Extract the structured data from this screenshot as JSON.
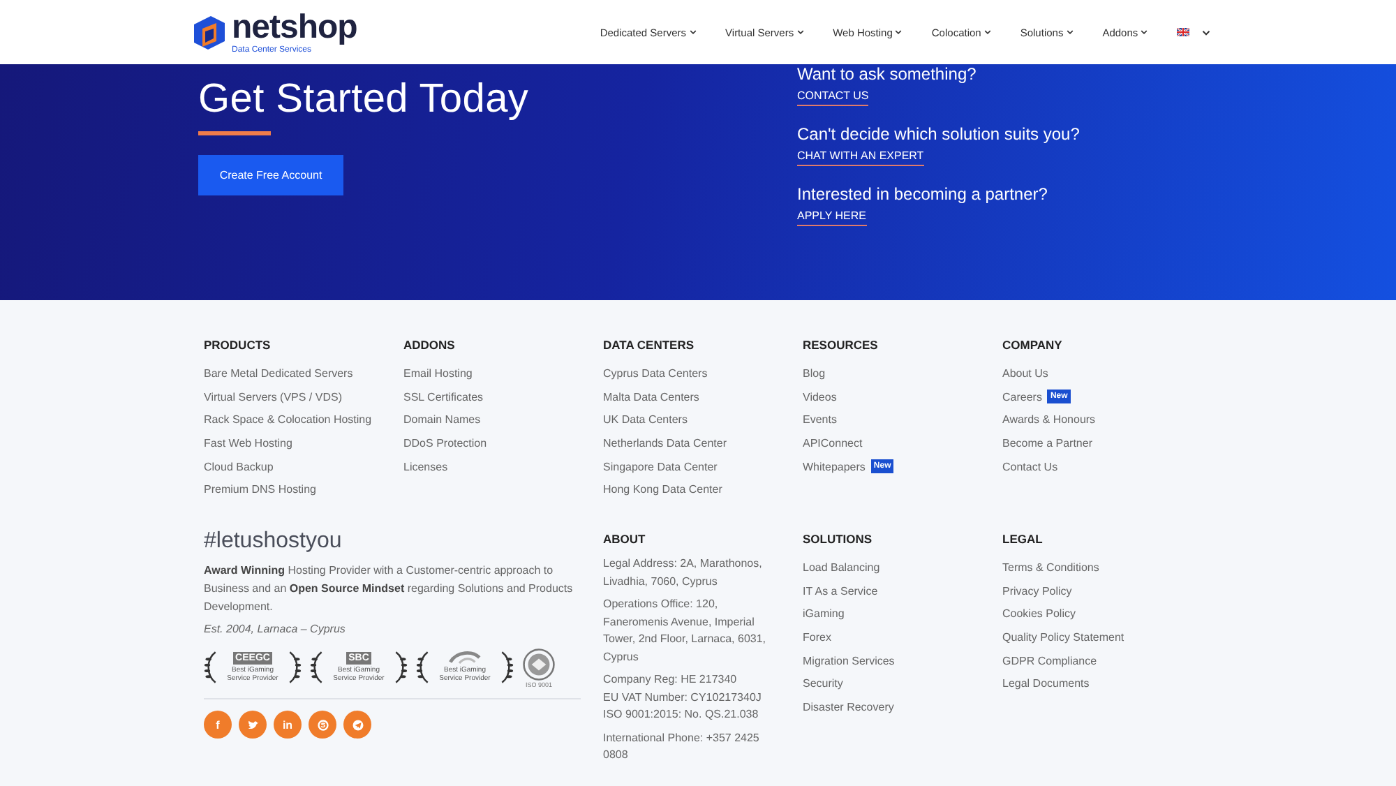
{
  "header": {
    "logo": {
      "name": "netshop",
      "tagline": "Data Center Services"
    },
    "nav": [
      {
        "label": "Dedicated Servers",
        "dropdown": true
      },
      {
        "label": "Virtual Servers",
        "dropdown": true
      },
      {
        "label": "Web Hosting",
        "dropdown": true
      },
      {
        "label": "Colocation",
        "dropdown": true
      },
      {
        "label": "Solutions",
        "dropdown": true
      },
      {
        "label": "Addons",
        "dropdown": true
      }
    ]
  },
  "hero": {
    "title": "Get Started Today",
    "button": "Create Free Account",
    "questions": [
      {
        "question": "Want to ask something?",
        "link": "CONTACT US"
      },
      {
        "question": "Can't decide which solution suits you?",
        "link": "CHAT WITH AN EXPERT"
      },
      {
        "question": "Interested in becoming a partner?",
        "link": "APPLY HERE"
      }
    ]
  },
  "columns": [
    {
      "heading": "PRODUCTS",
      "links": [
        {
          "label": "Bare Metal Dedicated Servers"
        },
        {
          "label": "Virtual Servers (VPS / VDS)"
        },
        {
          "label": "Rack Space & Colocation Hosting"
        },
        {
          "label": "Fast Web Hosting"
        },
        {
          "label": "Cloud Backup"
        },
        {
          "label": "Premium DNS Hosting"
        }
      ]
    },
    {
      "heading": "ADDONS",
      "links": [
        {
          "label": "Email Hosting"
        },
        {
          "label": "SSL Certificates"
        },
        {
          "label": "Domain Names"
        },
        {
          "label": "DDoS Protection"
        },
        {
          "label": "Licenses"
        }
      ]
    },
    {
      "heading": "DATA CENTERS",
      "links": [
        {
          "label": "Cyprus Data Centers"
        },
        {
          "label": "Malta Data Centers"
        },
        {
          "label": "UK Data Centers"
        },
        {
          "label": "Netherlands Data Center"
        },
        {
          "label": "Singapore Data Center"
        },
        {
          "label": "Hong Kong Data Center"
        }
      ]
    },
    {
      "heading": "RESOURCES",
      "links": [
        {
          "label": "Blog"
        },
        {
          "label": "Videos"
        },
        {
          "label": "Events"
        },
        {
          "label": "APIConnect"
        },
        {
          "label": "Whitepapers",
          "badge": "New"
        }
      ]
    },
    {
      "heading": "COMPANY",
      "links": [
        {
          "label": "About Us"
        },
        {
          "label": "Careers",
          "badge": "New"
        },
        {
          "label": "Awards & Honours"
        },
        {
          "label": "Become a Partner"
        },
        {
          "label": "Contact Us"
        }
      ]
    }
  ],
  "brand": {
    "hashtag": "#letushostyou",
    "description": "**Award Winning** Hosting Provider with a Customer-centric approach to Business and an **Open Source Mindset** regarding Solutions and Products Development.",
    "established": "Est. 2004, Larnaca – Cyprus",
    "awards": [
      {
        "kind": "laurel",
        "logo": "CEEGC",
        "caption": "Best iGaming Service Provider"
      },
      {
        "kind": "laurel",
        "logo": "SBC",
        "caption": "Best iGaming Service Provider"
      },
      {
        "kind": "laurel",
        "caption": "Best iGaming Service Provider"
      },
      {
        "kind": "seal",
        "caption": "ISO 9001"
      }
    ],
    "social": [
      {
        "kind": "letter",
        "glyph": "f"
      },
      {
        "kind": "bird"
      },
      {
        "kind": "letter",
        "glyph": "in"
      },
      {
        "kind": "ring"
      },
      {
        "kind": "plane"
      }
    ]
  },
  "about": {
    "heading": "ABOUT",
    "paragraphs": [
      {
        "lines": [
          "Legal Address: 2A, Marathonos, Livadhia, 7060, Cyprus"
        ]
      },
      {
        "lines": [
          "Operations Office: 120, Faneromenis Avenue, Imperial Tower, 2nd Floor, Larnaca, 6031, Cyprus"
        ]
      },
      {
        "lines": [
          "Company Reg: HE 217340",
          "EU VAT Number: CY10217340J",
          "ISO 9001:2015: No. QS.21.038"
        ]
      },
      {
        "lines": [
          "International Phone: +357 2425 0808"
        ]
      }
    ]
  },
  "lower_columns": [
    {
      "heading": "SOLUTIONS",
      "links": [
        {
          "label": "Load Balancing"
        },
        {
          "label": "IT As a Service"
        },
        {
          "label": "iGaming"
        },
        {
          "label": "Forex"
        },
        {
          "label": "Migration Services"
        },
        {
          "label": "Security"
        },
        {
          "label": "Disaster Recovery"
        }
      ]
    },
    {
      "heading": "LEGAL",
      "links": [
        {
          "label": "Terms & Conditions"
        },
        {
          "label": "Privacy Policy"
        },
        {
          "label": "Cookies Policy"
        },
        {
          "label": "Quality Policy Statement"
        },
        {
          "label": "GDPR Compliance"
        },
        {
          "label": "Legal Documents"
        }
      ]
    }
  ]
}
